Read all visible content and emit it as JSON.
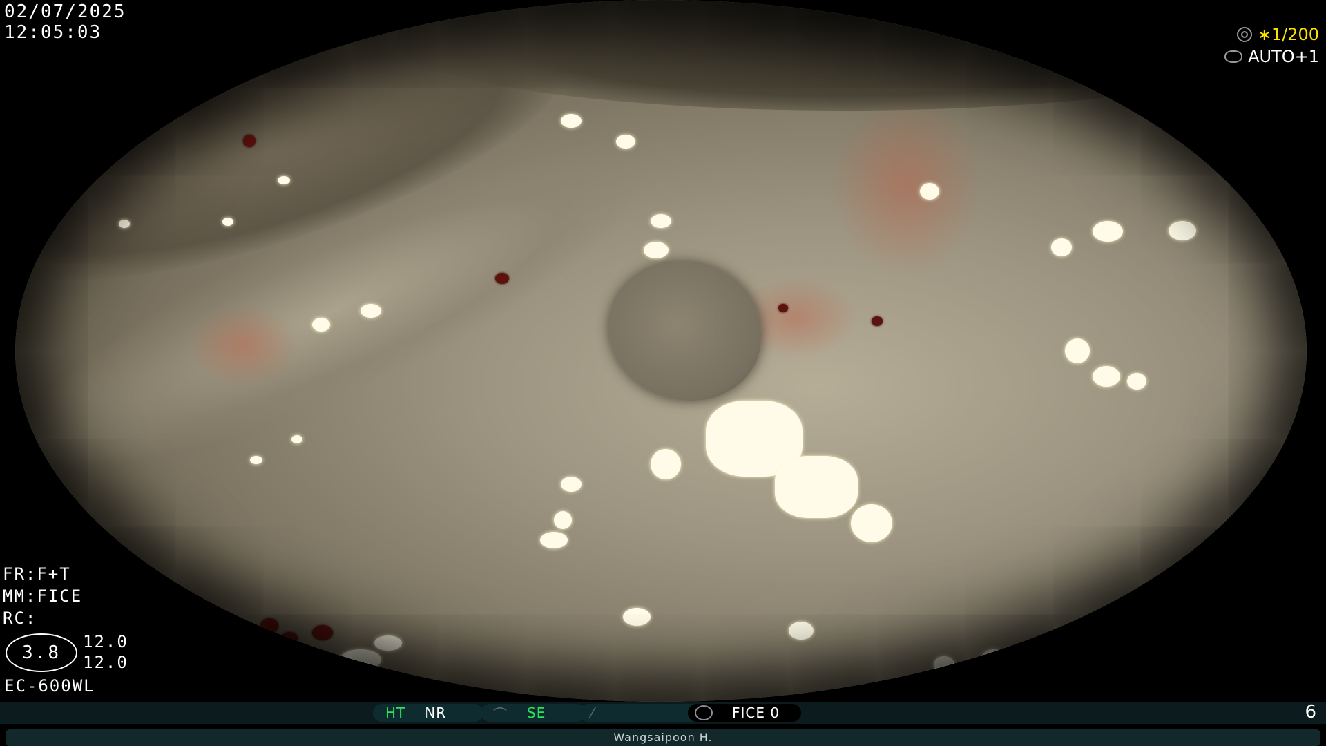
{
  "datetime": {
    "date": "02/07/2025",
    "time": "12:05:03"
  },
  "top_right": {
    "shutter_icon": "shutter-icon",
    "shutter_value": "∗1/200",
    "iris_icon": "iris-icon",
    "iris_value": "AUTO+1",
    "accent_color": "#ffe100"
  },
  "params": {
    "fr": "FR:F+T",
    "mm": "MM:FICE",
    "rc": "RC:"
  },
  "scale": {
    "oval": "3.8",
    "v1": "12.0",
    "v2": "12.0"
  },
  "scope_model": "EC-600WL",
  "status_bar": {
    "ht": "HT",
    "nr": "NR",
    "se": "SE",
    "fice": "FICE 0",
    "page": "6",
    "green_color": "#2fe05a"
  },
  "operator": "Wangsaipoon H."
}
